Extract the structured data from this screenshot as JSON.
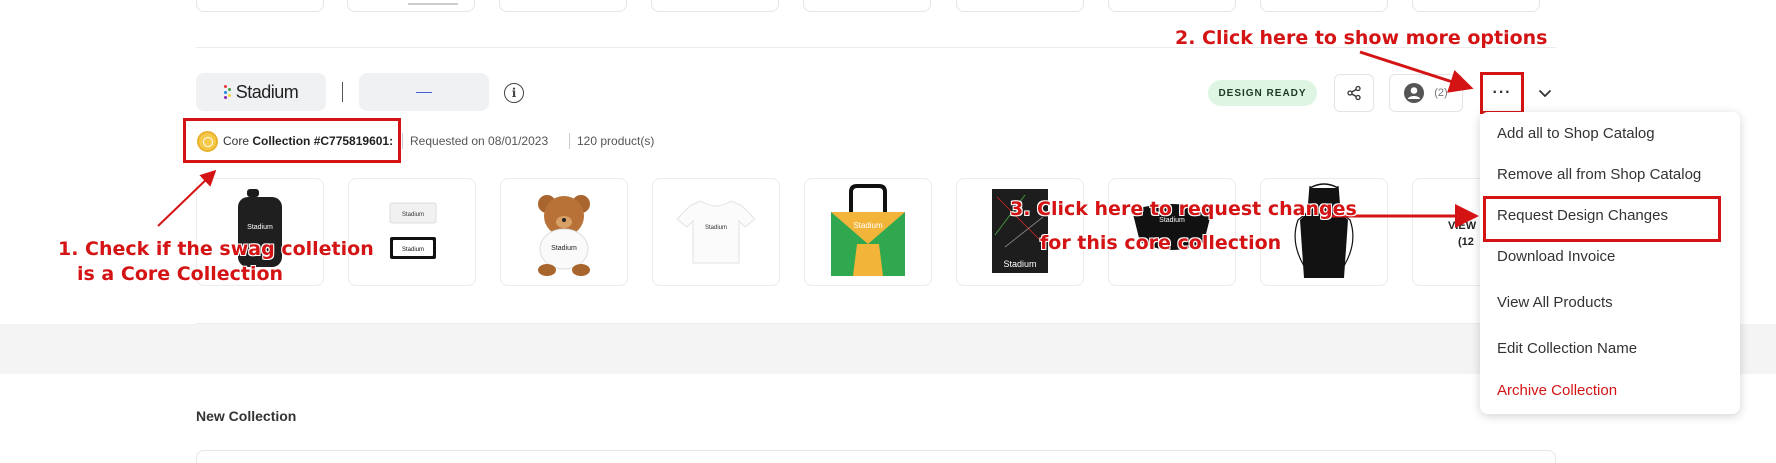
{
  "collection": {
    "brand_logo_text": "Stadium",
    "status_badge": "DESIGN READY",
    "user_count": "(2)",
    "more_button_label": "···",
    "core_label": "Core",
    "collection_id": "Collection #C775819601:",
    "requested_on": "Requested on 08/01/2023",
    "product_count": "120 product(s)",
    "view_more_line1": "VIEW",
    "view_more_line2": "(12",
    "products": [
      {
        "name": "water-bottle",
        "brand": "Stadium"
      },
      {
        "name": "stickers",
        "brand": "Stadium"
      },
      {
        "name": "teddy-bear",
        "brand": "Stadium"
      },
      {
        "name": "t-shirt",
        "brand": "Stadium"
      },
      {
        "name": "tote-bag",
        "brand": "Stadium"
      },
      {
        "name": "notebook",
        "brand": "Stadium"
      },
      {
        "name": "hat",
        "brand": "Stadium"
      },
      {
        "name": "apron",
        "brand": ""
      }
    ]
  },
  "menu": {
    "items": [
      "Add all to Shop Catalog",
      "Remove all from Shop Catalog",
      "Request Design Changes",
      "Download Invoice",
      "View All Products",
      "Edit Collection Name",
      "Archive Collection"
    ]
  },
  "section": {
    "new_collection_title": "New Collection"
  },
  "annotations": {
    "step1_line1": "1. Check if the swag colletion",
    "step1_line2": "is a Core Collection",
    "step2": "2. Click here to show more options",
    "step3_line1": "3. Click here to request changes",
    "step3_line2": "for this core collection"
  },
  "colors": {
    "annotation_red": "#d41414",
    "badge_green_bg": "#dff5e4",
    "coin_gold": "#f7c94a"
  }
}
